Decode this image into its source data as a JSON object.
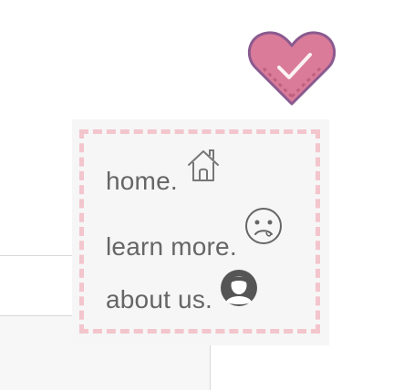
{
  "menu": {
    "items": [
      {
        "label": "home.",
        "icon": "home-icon"
      },
      {
        "label": "learn more.",
        "icon": "sad-face-icon"
      },
      {
        "label": "about us.",
        "icon": "user-avatar-icon"
      }
    ]
  },
  "badge": {
    "icon": "heart-check-icon"
  },
  "colors": {
    "heart_fill": "#d97b99",
    "heart_stroke": "#8a5a8f",
    "dashed_border": "#f3c5cc",
    "menu_bg": "#f6f6f6",
    "text": "#666666"
  }
}
